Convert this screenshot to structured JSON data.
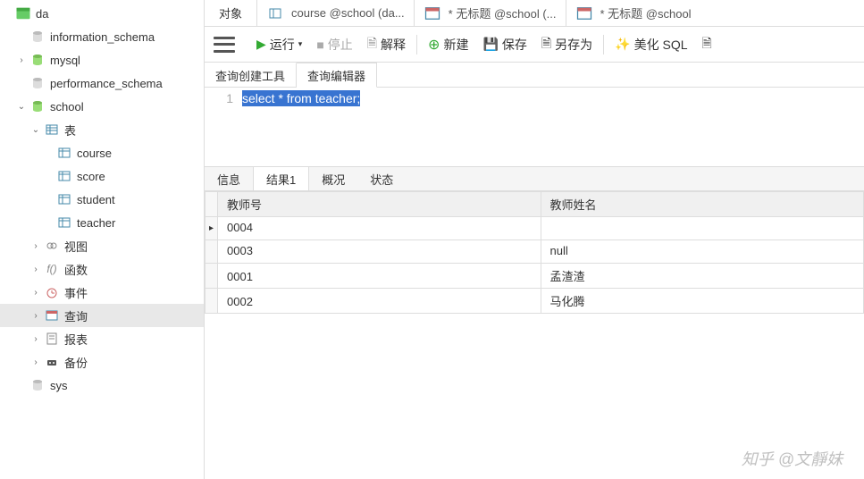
{
  "sidebar": {
    "connection": "da",
    "databases": [
      "information_schema",
      "mysql",
      "performance_schema",
      "school",
      "sys"
    ],
    "school": {
      "tables_label": "表",
      "tables": [
        "course",
        "score",
        "student",
        "teacher"
      ],
      "views": "视图",
      "functions": "函数",
      "events": "事件",
      "queries": "查询",
      "reports": "报表",
      "backup": "备份"
    }
  },
  "tabs": {
    "objects": "对象",
    "t1": "course @school (da...",
    "t2": "* 无标题 @school (...",
    "t3": "* 无标题 @school"
  },
  "toolbar": {
    "run": "运行",
    "stop": "停止",
    "explain": "解释",
    "new": "新建",
    "save": "保存",
    "saveas": "另存为",
    "beautify": "美化 SQL"
  },
  "subtabs": {
    "builder": "查询创建工具",
    "editor": "查询编辑器"
  },
  "editor": {
    "line1_no": "1",
    "sql": "select * from teacher;"
  },
  "result_tabs": {
    "info": "信息",
    "result1": "结果1",
    "profile": "概况",
    "status": "状态"
  },
  "grid": {
    "headers": [
      "教师号",
      "教师姓名"
    ],
    "rows": [
      {
        "id": "0004",
        "name": ""
      },
      {
        "id": "0003",
        "name": "null"
      },
      {
        "id": "0001",
        "name": "孟渣渣"
      },
      {
        "id": "0002",
        "name": "马化腾"
      }
    ]
  },
  "watermark": "知乎 @文靜妹"
}
